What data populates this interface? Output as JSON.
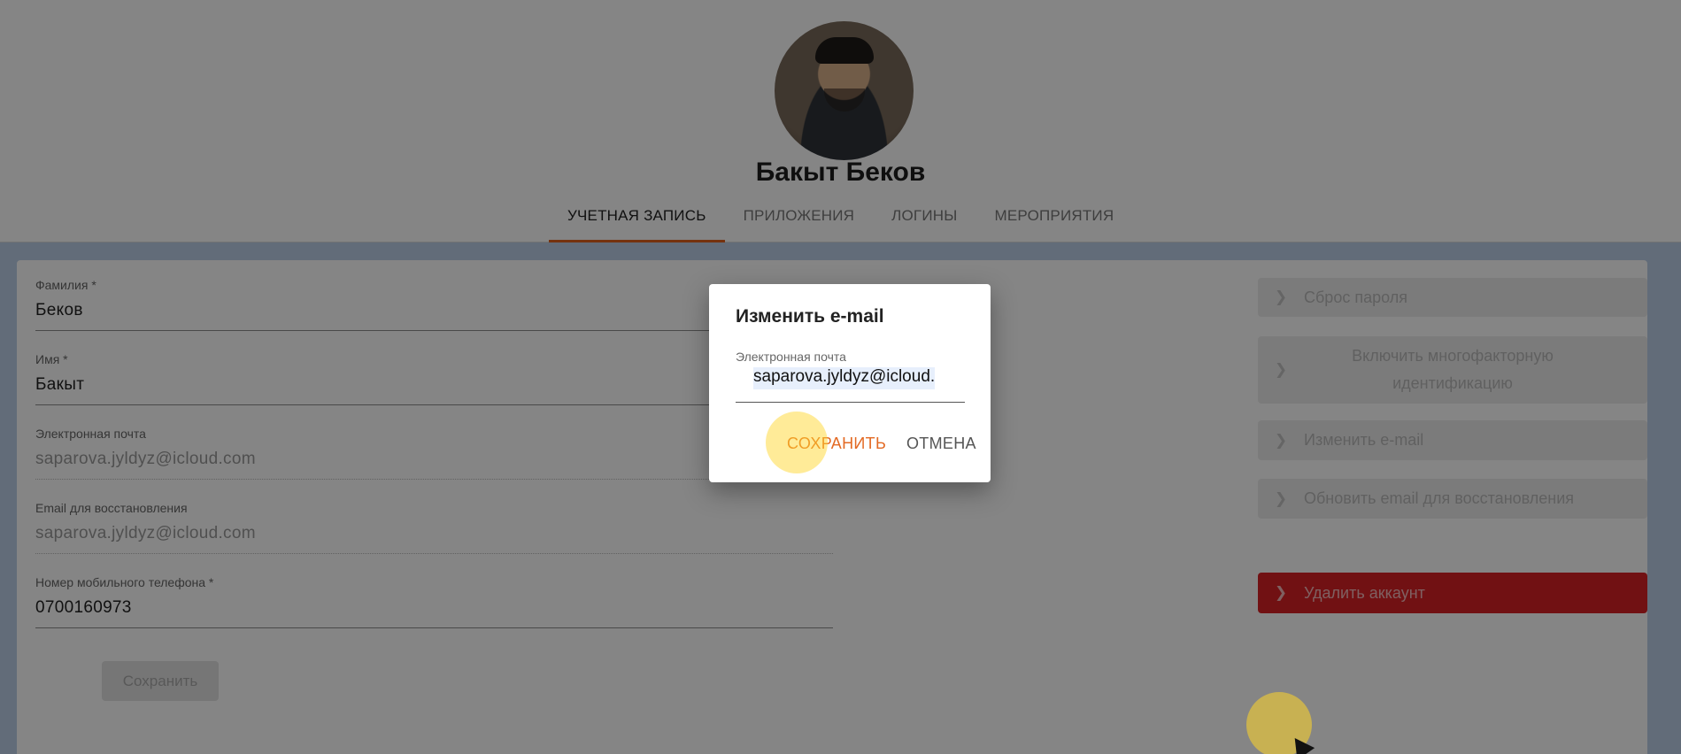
{
  "profile": {
    "name": "Бакыт Беков"
  },
  "tabs": [
    {
      "label": "УЧЕТНАЯ ЗАПИСЬ",
      "active": true
    },
    {
      "label": "ПРИЛОЖЕНИЯ"
    },
    {
      "label": "ЛОГИНЫ"
    },
    {
      "label": "МЕРОПРИЯТИЯ"
    }
  ],
  "form": {
    "surname": {
      "label": "Фамилия *",
      "value": "Беков"
    },
    "firstname": {
      "label": "Имя *",
      "value": "Бакыт"
    },
    "email": {
      "label": "Электронная почта",
      "value": "saparova.jyldyz@icloud.com"
    },
    "recovery_email": {
      "label": "Email для восстановления",
      "value": "saparova.jyldyz@icloud.com"
    },
    "phone": {
      "label": "Номер мобильного телефона *",
      "value": "0700160973"
    },
    "save_label": "Сохранить"
  },
  "actions": {
    "reset_password": "Сброс пароля",
    "enable_mfa": "Включить многофакторную идентификацию",
    "change_email": "Изменить e-mail",
    "update_recovery": "Обновить email для восстановления",
    "delete_account": "Удалить аккаунт"
  },
  "dialog": {
    "title": "Изменить e-mail",
    "field_label": "Электронная почта",
    "field_value": "saparova.jyldyz@icloud.",
    "save_label": "СОХРАНИТЬ",
    "cancel_label": "ОТМЕНА"
  },
  "colors": {
    "accent": "#e36a24",
    "danger": "#d92226"
  }
}
